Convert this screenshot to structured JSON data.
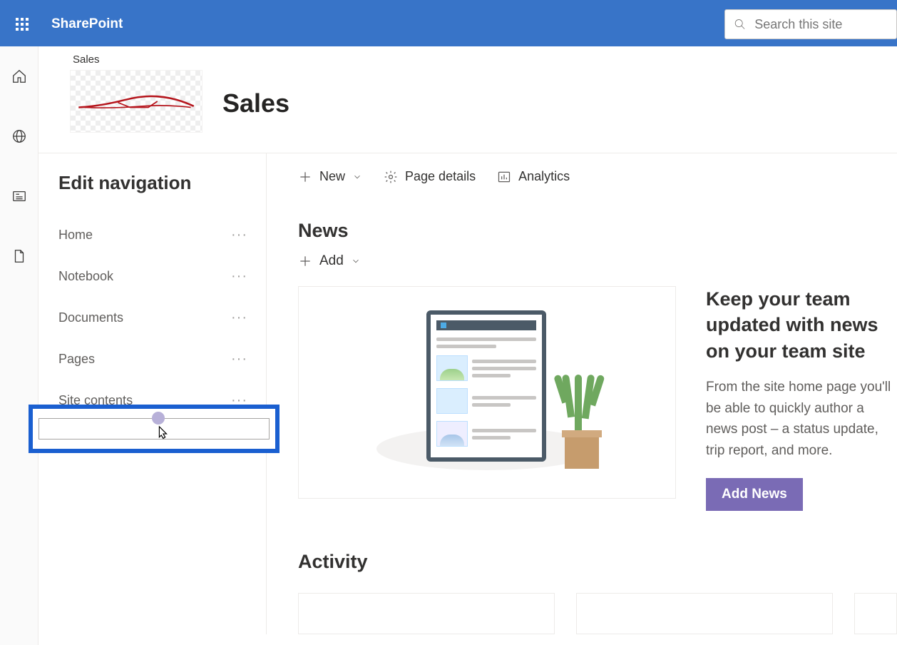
{
  "header": {
    "app_name": "SharePoint",
    "search_placeholder": "Search this site"
  },
  "rail": {
    "icons": [
      "home-icon",
      "globe-icon",
      "news-icon",
      "file-icon"
    ]
  },
  "site": {
    "breadcrumb": "Sales",
    "title": "Sales"
  },
  "left_pane": {
    "heading": "Edit navigation",
    "items": [
      {
        "label": "Home"
      },
      {
        "label": "Notebook"
      },
      {
        "label": "Documents"
      },
      {
        "label": "Pages"
      },
      {
        "label": "Site contents"
      }
    ]
  },
  "toolbar": {
    "new_label": "New",
    "details_label": "Page details",
    "analytics_label": "Analytics"
  },
  "news": {
    "section_title": "News",
    "add_label": "Add",
    "promo_heading": "Keep your team updated with news on your team site",
    "promo_body": "From the site home page you'll be able to quickly author a news post – a status update, trip report, and more.",
    "button_label": "Add News"
  },
  "activity": {
    "section_title": "Activity"
  }
}
